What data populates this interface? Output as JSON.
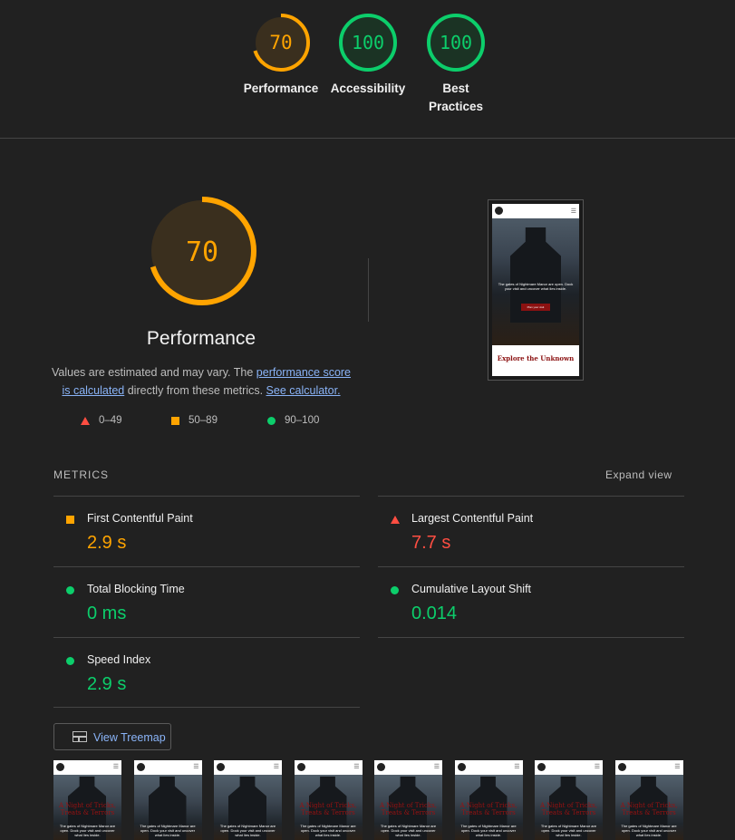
{
  "top_scores": [
    {
      "label": "Performance",
      "score": "70",
      "value": 70,
      "color": "#ffa400"
    },
    {
      "label": "Accessibility",
      "score": "100",
      "value": 100,
      "color": "#0cce6b"
    },
    {
      "label": "Best Practices",
      "score": "100",
      "value": 100,
      "color": "#0cce6b"
    }
  ],
  "performance": {
    "score": "70",
    "value": 70,
    "color": "#ffa400",
    "title": "Performance",
    "desc_prefix": "Values are estimated and may vary. The ",
    "desc_link1": "performance score is calculated",
    "desc_middle": " directly from these metrics. ",
    "desc_link2": "See calculator.",
    "legend": [
      {
        "range": "0–49",
        "shape": "triangle",
        "color": "#ff4e42"
      },
      {
        "range": "50–89",
        "shape": "square",
        "color": "#ffa400"
      },
      {
        "range": "90–100",
        "shape": "circle",
        "color": "#0cce6b"
      }
    ]
  },
  "screenshot": {
    "hero_text": "The gates of Nightmare Manor are open. Dock your visit and uncover what lies inside.",
    "button_label": "Plan your visit",
    "footer_text": "Explore the Unknown"
  },
  "metrics": {
    "heading": "METRICS",
    "expand_label": "Expand view",
    "items": [
      {
        "name": "First Contentful Paint",
        "value": "2.9 s",
        "status": "average",
        "color": "#ffa400"
      },
      {
        "name": "Largest Contentful Paint",
        "value": "7.7 s",
        "status": "fail",
        "color": "#ff4e42"
      },
      {
        "name": "Total Blocking Time",
        "value": "0 ms",
        "status": "pass",
        "color": "#0cce6b"
      },
      {
        "name": "Cumulative Layout Shift",
        "value": "0.014",
        "status": "pass",
        "color": "#0cce6b"
      },
      {
        "name": "Speed Index",
        "value": "2.9 s",
        "status": "pass",
        "color": "#0cce6b"
      }
    ]
  },
  "treemap": {
    "label": "View Treemap"
  },
  "filmstrip": [
    {
      "title": "A Night of Tricks, Treats & Terrors",
      "text": "The gates of Nightmare Manor are open. Dock your visit and uncover what lies inside."
    },
    {
      "title": "",
      "text": "The gates of Nightmare Manor are open. Dock your visit and uncover what lies inside."
    },
    {
      "title": "",
      "text": "The gates of Nightmare Manor are open. Dock your visit and uncover what lies inside."
    },
    {
      "title": "A Night of Tricks, Treats & Terrors",
      "text": "The gates of Nightmare Manor are open. Dock your visit and uncover what lies inside."
    },
    {
      "title": "A Night of Tricks, Treats & Terrors",
      "text": "The gates of Nightmare Manor are open. Dock your visit and uncover what lies inside."
    },
    {
      "title": "A Night of Tricks, Treats & Terrors",
      "text": "The gates of Nightmare Manor are open. Dock your visit and uncover what lies inside."
    },
    {
      "title": "A Night of Tricks, Treats & Terrors",
      "text": "The gates of Nightmare Manor are open. Dock your visit and uncover what lies inside."
    },
    {
      "title": "A Night of Tricks, Treats & Terrors",
      "text": "The gates of Nightmare Manor are open. Dock your visit and uncover what lies inside."
    }
  ]
}
